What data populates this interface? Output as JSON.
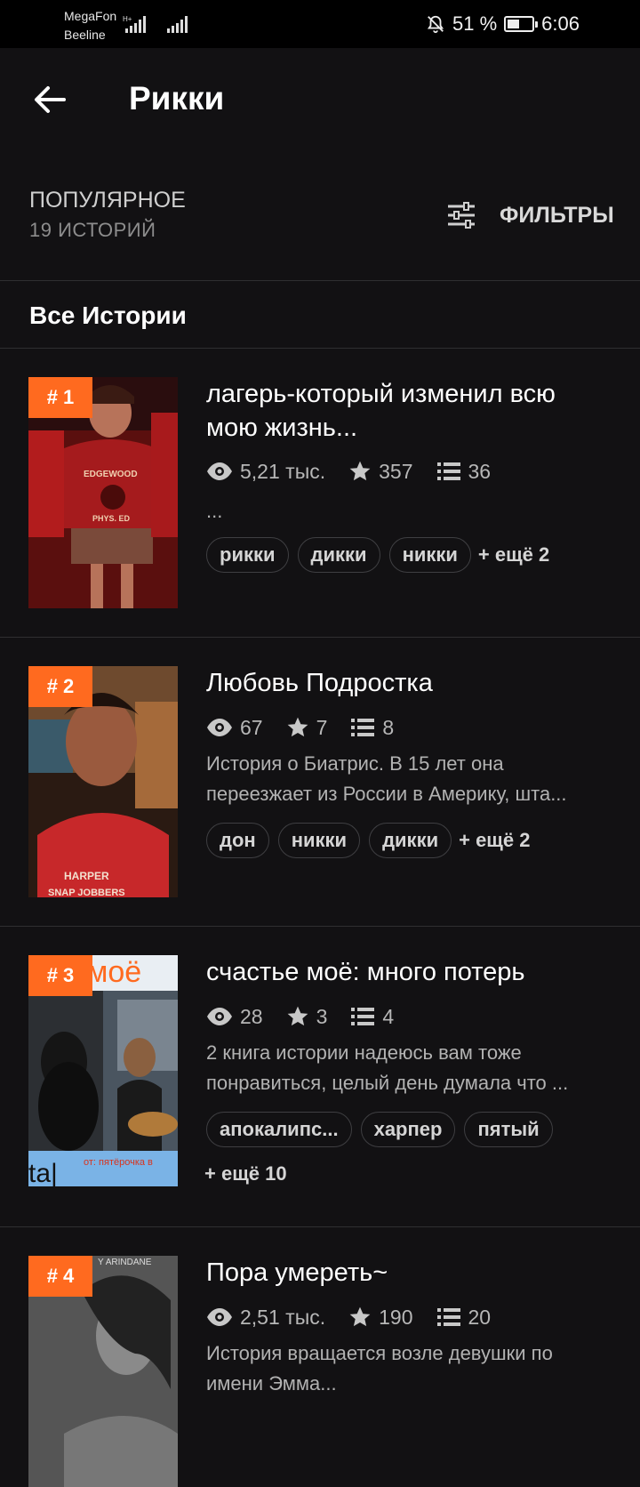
{
  "status_bar": {
    "carrier1": "MegaFon",
    "carrier2": "Beeline",
    "battery_text": "51 %",
    "battery_level": 0.51,
    "time": "6:06"
  },
  "header": {
    "title": "Рикки"
  },
  "sort": {
    "label": "ПОПУЛЯРНОЕ",
    "count": "19 ИСТОРИЙ"
  },
  "filters": {
    "label": "ФИЛЬТРЫ"
  },
  "section": {
    "title": "Все Истории"
  },
  "stories": [
    {
      "rank": "# 1",
      "title_lines": [
        "лагерь-который изменил всю",
        "мою жизнь..."
      ],
      "views": "5,21 тыс.",
      "votes": "357",
      "parts": "36",
      "desc_lines": [
        "..."
      ],
      "tags": [
        "рикки",
        "дикки",
        "никки"
      ],
      "more": "+ ещё 2"
    },
    {
      "rank": "# 2",
      "title_lines": [
        "Любовь Подростка"
      ],
      "views": "67",
      "votes": "7",
      "parts": "8",
      "desc_lines": [
        "История о Биатрис. В 15 лет она",
        "переезжает из России в Америку, шта..."
      ],
      "tags": [
        "дон",
        "никки",
        "дикки"
      ],
      "more": "+ ещё 2"
    },
    {
      "rank": "# 3",
      "title_lines": [
        "счастье моё: много потерь"
      ],
      "views": "28",
      "votes": "3",
      "parts": "4",
      "desc_lines": [
        "2 книга истории надеюсь вам тоже",
        "понравиться, целый день думала что ..."
      ],
      "tags": [
        "апокалипс...",
        "харпер",
        "пятый"
      ],
      "more": "+ ещё 10",
      "cover_text": "моё",
      "cover_text2": "от: пятёрочка в",
      "cover_text3": "ta|"
    },
    {
      "rank": "# 4",
      "title_lines": [
        "Пора умереть~"
      ],
      "views": "2,51 тыс.",
      "votes": "190",
      "parts": "20",
      "desc_lines": [
        "История вращается возле девушки по",
        "имени Эмма..."
      ],
      "cover_text": "Y ARINDANE"
    }
  ]
}
